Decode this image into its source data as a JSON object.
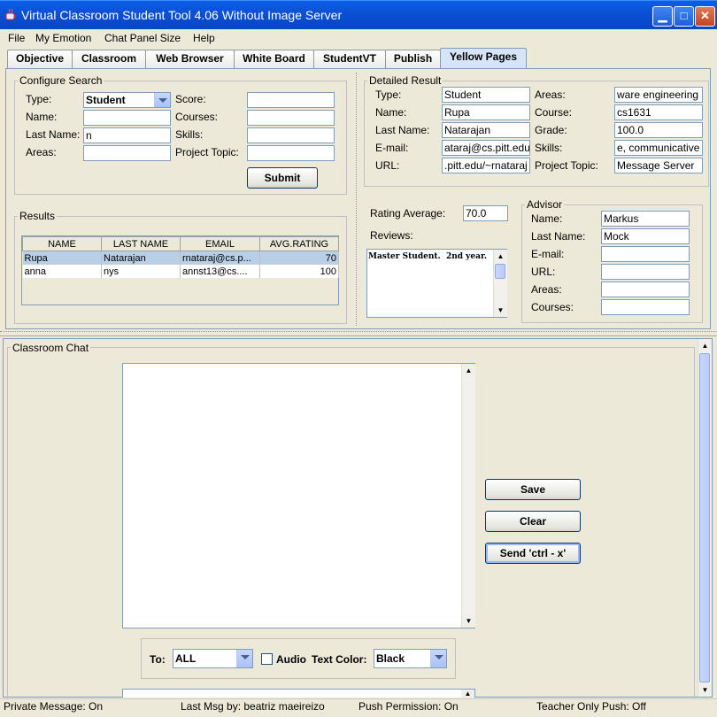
{
  "window": {
    "title": "Virtual Classroom Student Tool 4.06 Without Image Server"
  },
  "menu": [
    "File",
    "My Emotion",
    "Chat Panel Size",
    "Help"
  ],
  "tabs": [
    "Objective",
    "Classroom",
    "Web Browser",
    "White Board",
    "StudentVT",
    "Publish",
    "Yellow Pages"
  ],
  "active_tab": "Yellow Pages",
  "configure_search": {
    "title": "Configure Search",
    "type_label": "Type:",
    "type_value": "Student",
    "name_label": "Name:",
    "name_value": "",
    "last_name_label": "Last Name:",
    "last_name_value": "n",
    "areas_label": "Areas:",
    "areas_value": "",
    "score_label": "Score:",
    "score_value": "",
    "courses_label": "Courses:",
    "courses_value": "",
    "skills_label": "Skills:",
    "skills_value": "",
    "project_topic_label": "Project Topic:",
    "project_topic_value": "",
    "submit_label": "Submit"
  },
  "results": {
    "title": "Results",
    "columns": [
      "NAME",
      "LAST NAME",
      "EMAIL",
      "AVG.RATING"
    ],
    "rows": [
      [
        "Rupa",
        "Natarajan",
        "rnataraj@cs.p...",
        "70"
      ],
      [
        "anna",
        "nys",
        "annst13@cs....",
        "100"
      ]
    ]
  },
  "detailed": {
    "title": "Detailed Result",
    "type_label": "Type:",
    "type_value": "Student",
    "name_label": "Name:",
    "name_value": "Rupa",
    "last_name_label": "Last Name:",
    "last_name_value": "Natarajan",
    "email_label": "E-mail:",
    "email_value": "ataraj@cs.pitt.edu",
    "url_label": "URL:",
    "url_value": ".pitt.edu/~rnataraj",
    "areas_label": "Areas:",
    "areas_value": "ware engineering",
    "course_label": "Course:",
    "course_value": "cs1631",
    "grade_label": "Grade:",
    "grade_value": "100.0",
    "skills_label": "Skills:",
    "skills_value": "e, communicative",
    "project_topic_label": "Project Topic:",
    "project_topic_value": "Message Server",
    "rating_label": "Rating Average:",
    "rating_value": "70.0",
    "reviews_label": "Reviews:",
    "reviews_text": "Master Student.  2nd year."
  },
  "advisor": {
    "title": "Advisor",
    "name_label": "Name:",
    "name_value": "Markus",
    "last_name_label": "Last Name:",
    "last_name_value": "Mock",
    "email_label": "E-mail:",
    "email_value": "",
    "url_label": "URL:",
    "url_value": "",
    "areas_label": "Areas:",
    "areas_value": "",
    "courses_label": "Courses:",
    "courses_value": ""
  },
  "chat": {
    "title": "Classroom Chat",
    "save_label": "Save",
    "clear_label": "Clear",
    "send_label": "Send 'ctrl - x'",
    "to_label": "To:",
    "to_value": "ALL",
    "audio_label": "Audio",
    "text_color_label": "Text Color:",
    "text_color_value": "Black"
  },
  "status": {
    "private": "Private Message: On",
    "last_msg": "Last Msg by: beatriz maeireizo",
    "push": "Push Permission: On",
    "teacher_push": "Teacher Only Push: Off"
  },
  "colors": {
    "titlebar": "#0b4fd4",
    "active_tab": "#d6e4f7",
    "selected_row": "#b8cfe5"
  }
}
